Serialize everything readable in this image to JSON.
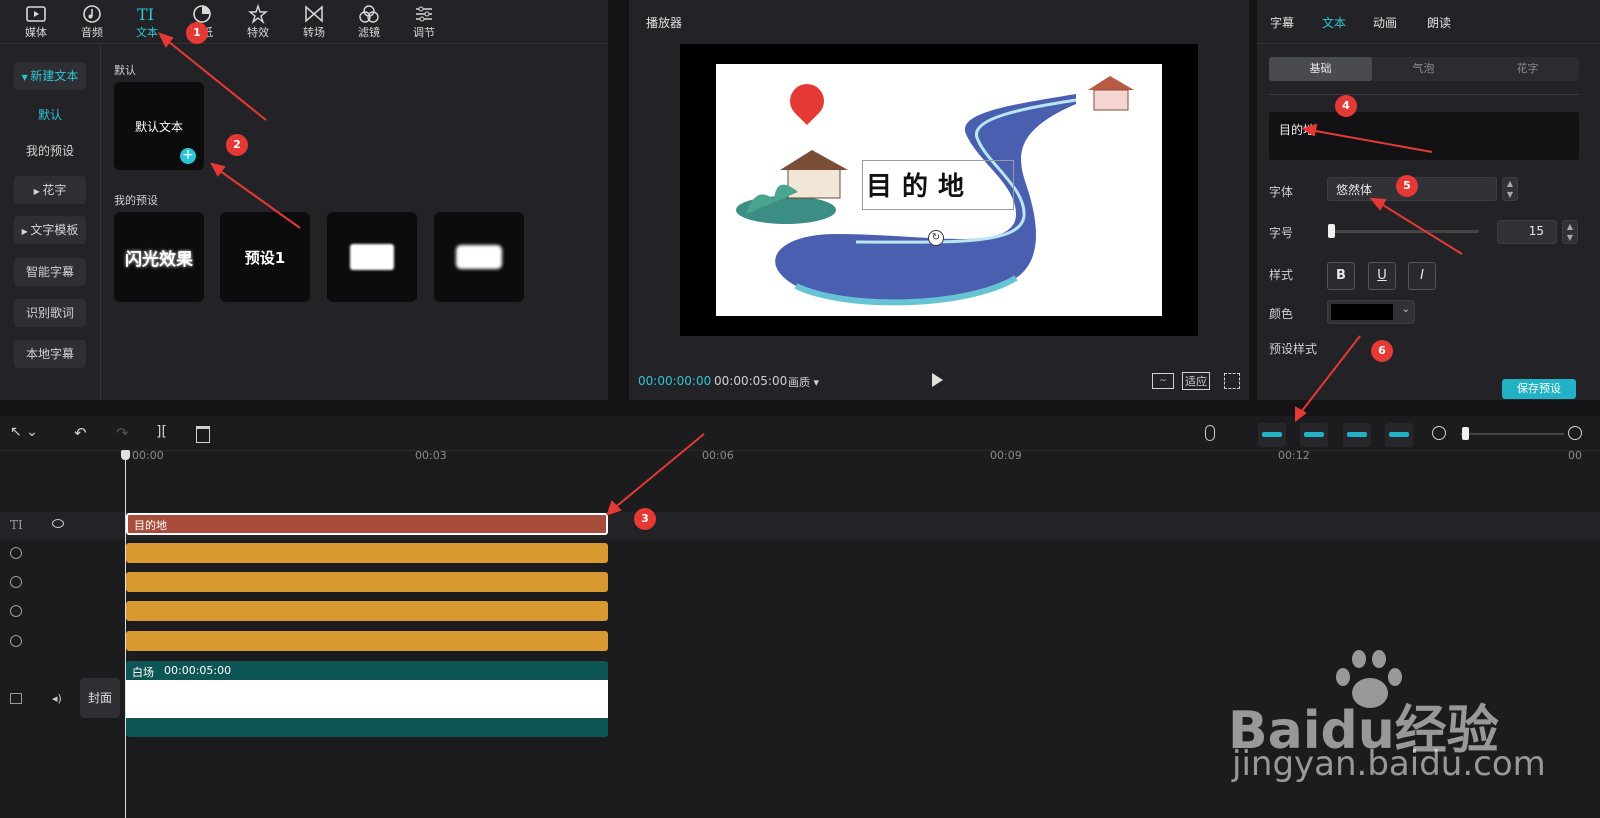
{
  "media_tabs": [
    {
      "label": "媒体",
      "icon": "media-icon"
    },
    {
      "label": "音频",
      "icon": "audio-icon"
    },
    {
      "label": "文本",
      "icon": "text-icon"
    },
    {
      "label": "贴纸",
      "icon": "sticker-icon"
    },
    {
      "label": "特效",
      "icon": "effects-icon"
    },
    {
      "label": "转场",
      "icon": "transition-icon"
    },
    {
      "label": "滤镜",
      "icon": "filter-icon"
    },
    {
      "label": "调节",
      "icon": "adjust-icon"
    }
  ],
  "text_sidebar": {
    "new_text": "新建文本",
    "default": "默认",
    "my_presets": "我的预设",
    "fancy": "花字",
    "templates": "文字模板",
    "smart_captions": "智能字幕",
    "lyrics": "识别歌词",
    "local_captions": "本地字幕"
  },
  "text_library": {
    "default_section": "默认",
    "default_text_card": "默认文本",
    "my_presets_section": "我的预设",
    "presets": [
      "闪光效果",
      "预设1",
      "",
      ""
    ]
  },
  "player": {
    "title": "播放器",
    "current_time": "00:00:00:00",
    "total_time": "00:00:05:00",
    "quality": "画质",
    "fit": "适应",
    "canvas_text": "目的地"
  },
  "inspector": {
    "tabs": [
      "字幕",
      "文本",
      "动画",
      "朗读"
    ],
    "active_tab": "文本",
    "sub_tabs": [
      "基础",
      "气泡",
      "花字"
    ],
    "text_value": "目的地",
    "font_label": "字体",
    "font_value": "悠然体",
    "size_label": "字号",
    "size_value": "15",
    "style_label": "样式",
    "style_buttons": [
      "B",
      "U",
      "I"
    ],
    "color_label": "颜色",
    "color_value": "#000000",
    "preset_style_label": "预设样式",
    "save_preset": "保存预设"
  },
  "timeline": {
    "ticks": [
      "00:00",
      "00:03",
      "00:06",
      "00:09",
      "00:12",
      "00"
    ],
    "text_clip": "目的地",
    "main_clip_name": "白场",
    "main_clip_duration": "00:00:05:00",
    "cover_label": "封面"
  },
  "annotations": [
    "1",
    "2",
    "3",
    "4",
    "5",
    "6"
  ],
  "watermark": {
    "brand": "Baidu经验",
    "url": "jingyan.baidu.com"
  }
}
